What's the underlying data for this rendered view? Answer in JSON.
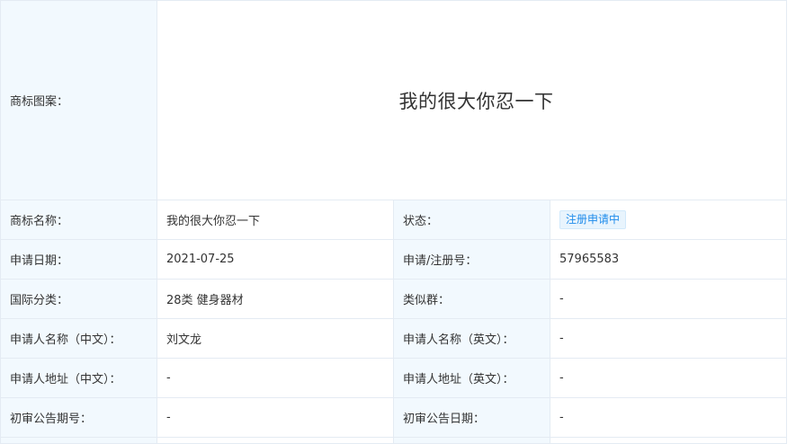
{
  "logo": {
    "label": "商标图案：",
    "text": "我的很大你忍一下"
  },
  "rows": [
    {
      "l1": "商标名称：",
      "v1": "我的很大你忍一下",
      "l2": "状态：",
      "v2": "注册申请中"
    },
    {
      "l1": "申请日期：",
      "v1": "2021-07-25",
      "l2": "申请/注册号：",
      "v2": "57965583"
    },
    {
      "l1": "国际分类：",
      "v1": "28类 健身器材",
      "l2": "类似群：",
      "v2": "-"
    },
    {
      "l1": "申请人名称（中文）：",
      "v1": "刘文龙",
      "l2": "申请人名称（英文）：",
      "v2": "-"
    },
    {
      "l1": "申请人地址（中文）：",
      "v1": "-",
      "l2": "申请人地址（英文）：",
      "v2": "-"
    },
    {
      "l1": "初审公告期号：",
      "v1": "-",
      "l2": "初审公告日期：",
      "v2": "-"
    }
  ],
  "colors": {
    "label_bg": "#f2f9fe",
    "border": "#e4ebf3",
    "status_text": "#1f8ceb",
    "status_bg": "#e8f4fd"
  }
}
